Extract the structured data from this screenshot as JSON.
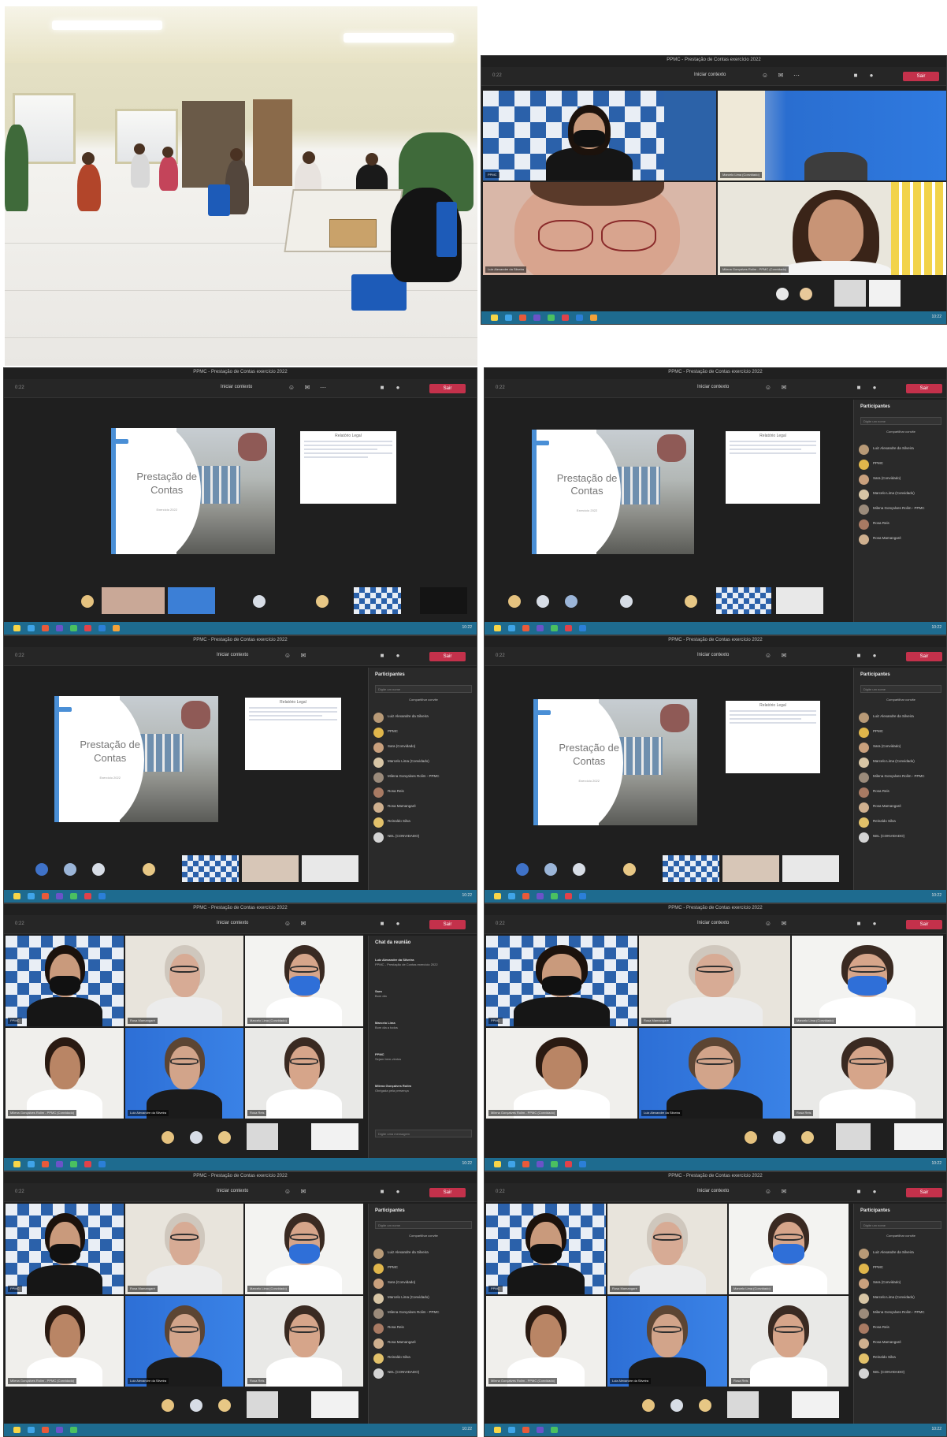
{
  "meeting": {
    "window_title": "PPMC - Prestação de Contas exercício 2022",
    "toolbar_left": "0:22",
    "share_label": "Iniciar contexto",
    "leave_label": "Sair"
  },
  "slide": {
    "title_line1": "Prestação de",
    "title_line2": "Contas",
    "subtitle": "Exercício 2022",
    "doc_title": "Relatório Legal"
  },
  "panel": {
    "participants_header": "Participantes",
    "search_placeholder": "Digite um nome",
    "share_invite": "Compartilhar convite",
    "chat_header": "Chat da reunião",
    "chat_input_placeholder": "Digite uma mensagem",
    "participants": [
      {
        "name": "Luiz Alexandre da Silveira",
        "color": "#b89a77"
      },
      {
        "name": "PPMC",
        "color": "#e0b64b"
      },
      {
        "name": "Sara (Convidado)",
        "color": "#c9a07d"
      },
      {
        "name": "Marcelo Lima (Convidado)",
        "color": "#d7c5a5"
      },
      {
        "name": "Milena Gonçalves Rolim - PPMC",
        "color": "#9b8b7b"
      },
      {
        "name": "Rosa Reis",
        "color": "#a87a63"
      },
      {
        "name": "Rosa Mamangaré",
        "color": "#cfb08f"
      },
      {
        "name": "Reinaldo Silva",
        "color": "#e2c16a"
      },
      {
        "name": "NEL (CONVIDADO)",
        "color": "#d4d4d4"
      }
    ],
    "chat_messages": [
      {
        "author": "Luiz Alexandre da Silveira",
        "text": "PPMC - Prestação de Contas exercício 2022"
      },
      {
        "author": "Sara",
        "text": "Bom dia"
      },
      {
        "author": "Marcelo Lima",
        "text": "Bom dia a todos"
      },
      {
        "author": "PPMC",
        "text": "Sejam bem-vindos"
      },
      {
        "author": "Milena Gonçalves Rolim",
        "text": "Obrigada pela presença"
      }
    ]
  },
  "tiles": {
    "names": [
      "PPMC",
      "Rosa Mamangaré",
      "Marcelo Lima (Convidado)",
      "Milena Gonçalves Rolim - PPMC (Convidado)",
      "Luiz Alexandre da Silveira",
      "Rosa Reis"
    ]
  },
  "taskbar": {
    "time": "10:22",
    "date": "26/07/2022"
  }
}
